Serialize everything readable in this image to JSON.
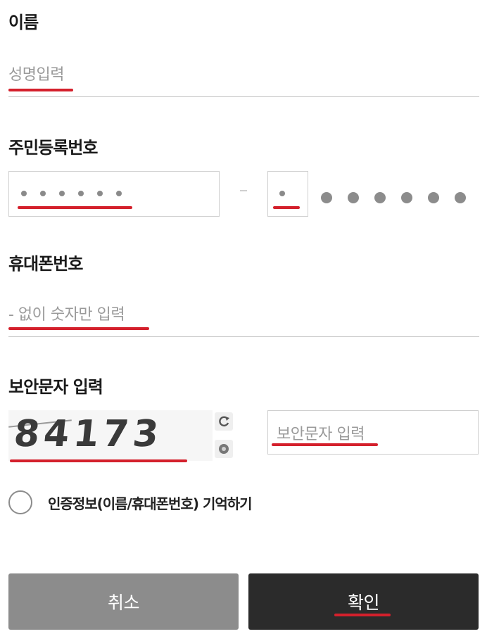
{
  "name_section": {
    "label": "이름",
    "placeholder": "성명입력"
  },
  "rrn_section": {
    "label": "주민등록번호",
    "dash": "-"
  },
  "phone_section": {
    "label": "휴대폰번호",
    "placeholder": "- 없이 숫자만 입력"
  },
  "captcha_section": {
    "label": "보안문자 입력",
    "captcha_text": "84173",
    "input_placeholder": "보안문자 입력",
    "refresh_icon": "refresh-icon",
    "audio_icon": "audio-icon"
  },
  "remember": {
    "label": "인증정보(이름/휴대폰번호) 기억하기",
    "checked": false
  },
  "buttons": {
    "cancel": "취소",
    "confirm": "확인"
  },
  "colors": {
    "accent_red": "#d4202c",
    "cancel_bg": "#8c8c8c",
    "confirm_bg": "#2b2b2b"
  }
}
